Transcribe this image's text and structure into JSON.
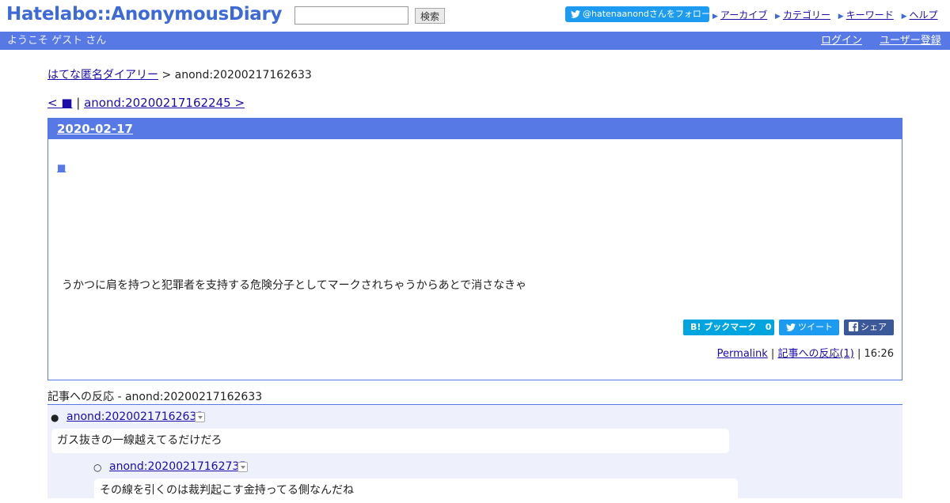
{
  "header": {
    "logo": "Hatelabo::AnonymousDiary",
    "search_placeholder": "",
    "search_button": "検索",
    "follow_button": "@hatenaanondさんをフォロー",
    "links": [
      "アーカイブ",
      "カテゴリー",
      "キーワード",
      "ヘルプ"
    ]
  },
  "bar": {
    "welcome": "ようこそ ゲスト さん",
    "login": "ログイン",
    "register": "ユーザー登録"
  },
  "breadcrumb": {
    "home": "はてな匿名ダイアリー",
    "sep": " > ",
    "current": "anond:20200217162633"
  },
  "pager": {
    "prev": "< ■",
    "sep": " | ",
    "next": "anond:20200217162245 >"
  },
  "day": {
    "date": "2020-02-17",
    "entry_link": "■",
    "text": "うかつに肩を持つと犯罪者を支持する危険分子としてマークされちゃうからあとで消さなきゃ",
    "share": {
      "bookmark": "ブックマーク",
      "bookmark_prefix": "B!",
      "bookmark_count": "0",
      "tweet": "ツイート",
      "facebook": "シェア"
    },
    "footer": {
      "permalink": "Permalink",
      "sep": " | ",
      "reactions": "記事への反応(1)",
      "sep2": " | ",
      "time": "16:26"
    }
  },
  "refer": {
    "title": "記事への反応 - anond:20200217162633",
    "items": [
      {
        "link": "anond:20200217162633",
        "text": "ガス抜きの一線越えてるだけだろ"
      },
      {
        "link": "anond:20200217162735",
        "text": "その線を引くのは裁判起こす金持ってる側なんだね"
      }
    ]
  },
  "colors": {
    "accent": "#5679e6",
    "logo": "#3d6ad6",
    "twitter": "#1d9bf0",
    "hatena": "#00a4de",
    "facebook": "#3b5998",
    "refer_bg": "#eef1fc"
  },
  "icons": [
    "twitter-bird-icon",
    "arrow-icon",
    "hatena-bookmark-icon",
    "facebook-icon",
    "dropdown-icon"
  ]
}
